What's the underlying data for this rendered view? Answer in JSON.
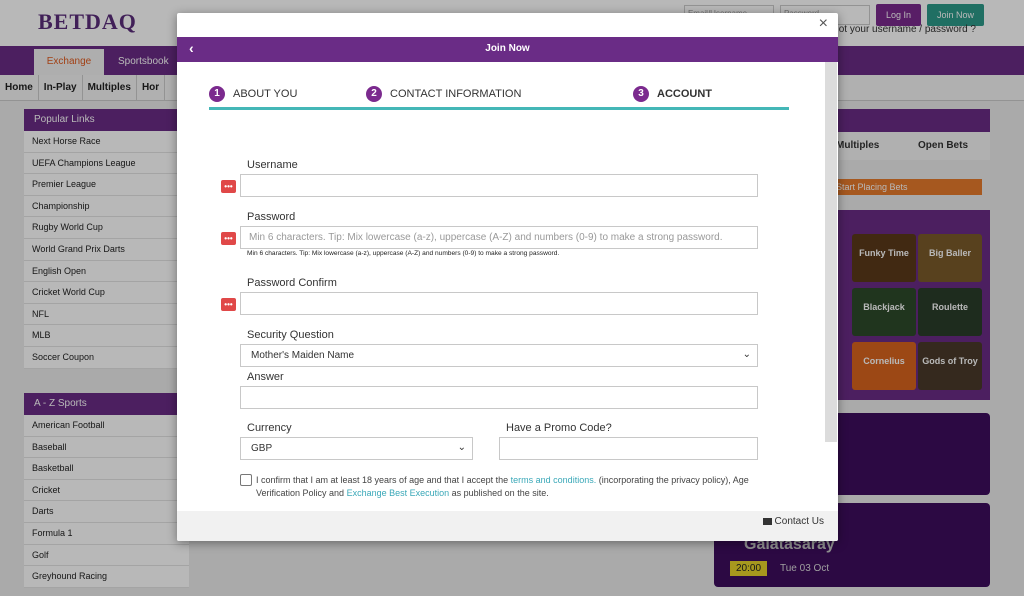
{
  "site": {
    "logo": "BETDAQ",
    "login": {
      "username_placeholder": "Email/Username",
      "password_placeholder": "Password",
      "login_label": "Log In",
      "join_label": "Join Now",
      "forgot": "Forgot your username / password ?"
    },
    "main_tabs": [
      "Exchange",
      "Sportsbook"
    ],
    "subnav": [
      "Home",
      "In-Play",
      "Multiples",
      "Hor"
    ],
    "popular_links": {
      "title": "Popular Links",
      "items": [
        "Next Horse Race",
        "UEFA Champions League",
        "Premier League",
        "Championship",
        "Rugby World Cup",
        "World Grand Prix Darts",
        "English Open",
        "Cricket World Cup",
        "NFL",
        "MLB",
        "Soccer Coupon"
      ]
    },
    "az_sports": {
      "title": "A - Z Sports",
      "items": [
        "American Football",
        "Baseball",
        "Basketball",
        "Cricket",
        "Darts",
        "Formula 1",
        "Golf",
        "Greyhound Racing"
      ]
    },
    "right_panel": {
      "tabs": [
        "Multiples",
        "Open Bets"
      ],
      "place_button": "Start Placing Bets",
      "games": [
        "Funky Time",
        "Big Baller",
        "Blackjack",
        "Roulette",
        "Cornelius",
        "Gods of Troy"
      ],
      "promo_team": "Galatasaray",
      "promo_time": "20:00",
      "promo_date": "Tue 03 Oct"
    }
  },
  "modal": {
    "title": "Join Now",
    "close": "×",
    "back": "‹",
    "steps": [
      {
        "num": "1",
        "label": "ABOUT YOU"
      },
      {
        "num": "2",
        "label": "CONTACT INFORMATION"
      },
      {
        "num": "3",
        "label": "ACCOUNT"
      }
    ],
    "username_label": "Username",
    "username_value": "",
    "password_label": "Password",
    "password_placeholder": "Min 6 characters. Tip: Mix lowercase (a-z), uppercase (A-Z) and numbers (0-9) to make a strong password.",
    "password_hint": "Min 6 characters. Tip: Mix lowercase (a-z), uppercase (A-Z) and numbers (0-9) to make a strong password.",
    "password_confirm_label": "Password Confirm",
    "security_question_label": "Security Question",
    "security_question_value": "Mother's Maiden Name",
    "answer_label": "Answer",
    "currency_label": "Currency",
    "currency_value": "GBP",
    "promo_label": "Have a Promo Code?",
    "terms_prefix": "I confirm that I am at least 18 years of age and that I accept the ",
    "terms_link": "terms and conditions.",
    "terms_middle": " (incorporating the privacy policy), Age Verification Policy and ",
    "terms_link2": "Exchange Best Execution",
    "terms_suffix": " as published on the site.",
    "required_marker": "•••",
    "contact": "Contact Us"
  },
  "colors": {
    "brand_purple": "#6a2c86",
    "accent_teal": "#44b7b7",
    "required_red": "#e04848",
    "link": "#3aa8b8"
  }
}
